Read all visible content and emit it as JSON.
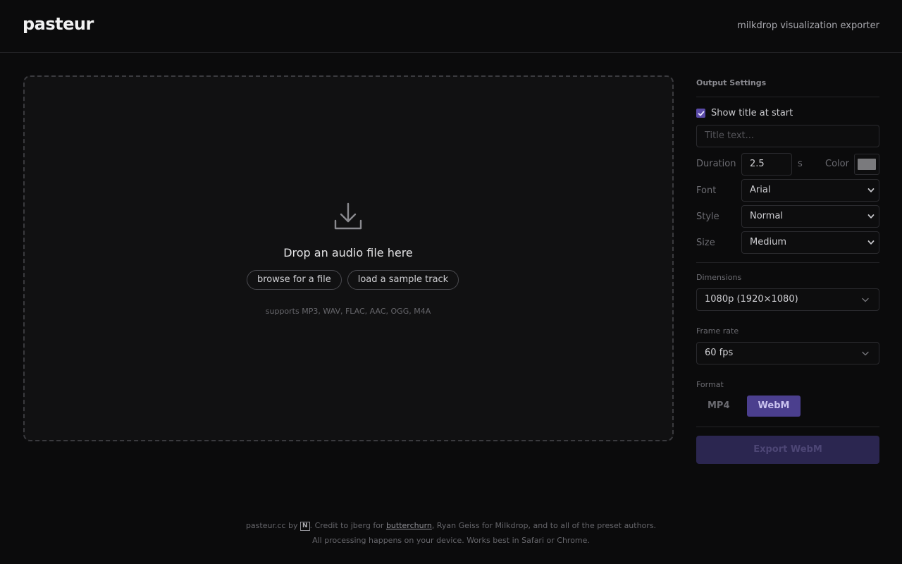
{
  "header": {
    "logo": "pasteur",
    "tagline": "milkdrop visualization exporter"
  },
  "dropzone": {
    "icon": "download-icon",
    "title": "Drop an audio file here",
    "browse_label": "browse for a file",
    "sample_label": "load a sample track",
    "supports": "supports MP3, WAV, FLAC, AAC, OGG, M4A"
  },
  "settings": {
    "title": "Output Settings",
    "show_title": {
      "label": "Show title at start",
      "checked": true
    },
    "title_text": {
      "placeholder": "Title text...",
      "value": ""
    },
    "duration": {
      "label": "Duration",
      "value": "2.5",
      "unit": "s"
    },
    "color": {
      "label": "Color",
      "value": "#7a7a7d"
    },
    "font": {
      "label": "Font",
      "value": "Arial"
    },
    "style": {
      "label": "Style",
      "value": "Normal"
    },
    "size": {
      "label": "Size",
      "value": "Medium"
    },
    "dimensions": {
      "label": "Dimensions",
      "value": "1080p (1920×1080)"
    },
    "frame_rate": {
      "label": "Frame rate",
      "value": "60 fps"
    },
    "format": {
      "label": "Format",
      "options": [
        "MP4",
        "WebM"
      ],
      "selected": "WebM"
    },
    "export_label": "Export WebM"
  },
  "footer": {
    "line1_prefix": "pasteur.cc by",
    "line1_badge": "N",
    "line1_mid": ". Credit to jberg for",
    "line1_link": "butterchurn",
    "line1_suffix": ", Ryan Geiss for Milkdrop, and to all of the preset authors.",
    "line2": "All processing happens on your device. Works best in Safari or Chrome."
  },
  "colors": {
    "accent": "#4b3f8e",
    "background": "#0b0b0c"
  }
}
